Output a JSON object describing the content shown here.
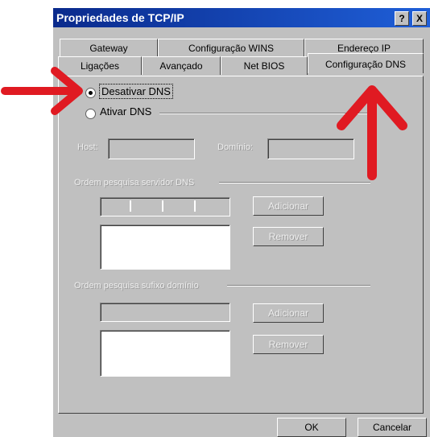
{
  "window": {
    "title": "Propriedades de TCP/IP",
    "help_label": "?",
    "close_label": "X"
  },
  "tabs": {
    "row_back": [
      {
        "label": "Gateway"
      },
      {
        "label": "Configuração WINS"
      },
      {
        "label": "Endereço IP"
      }
    ],
    "row_front": [
      {
        "label": "Ligações"
      },
      {
        "label": "Avançado"
      },
      {
        "label": "Net BIOS"
      },
      {
        "label": "Configuração DNS"
      }
    ]
  },
  "dns": {
    "disable_label": "Desativar DNS",
    "enable_label": "Ativar DNS",
    "selected": "Desativar DNS",
    "host_label": "Host:",
    "domain_label": "Domínio:",
    "server_group_label": "Ordem pesquisa servidor DNS",
    "suffix_group_label": "Ordem pesquisa sufixo domínio",
    "add_label": "Adicionar",
    "remove_label": "Remover"
  },
  "footer": {
    "ok_label": "OK",
    "cancel_label": "Cancelar"
  },
  "colors": {
    "titlebar": "#0a2a8c",
    "dialog": "#c0c0c0",
    "arrow": "#e01a22"
  }
}
